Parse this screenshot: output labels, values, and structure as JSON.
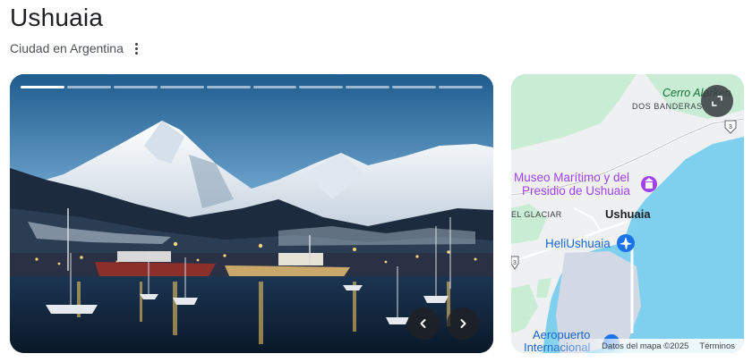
{
  "header": {
    "title": "Ushuaia",
    "subtitle": "Ciudad en Argentina",
    "more_icon": "more-vert-icon"
  },
  "carousel": {
    "slide_count": 10,
    "active_slide": 1,
    "prev_icon": "chevron-left-icon",
    "next_icon": "chevron-right-icon"
  },
  "map": {
    "labels": {
      "cerro": "Cerro Alarken",
      "dos_banderas": "DOS BANDERAS",
      "museo_line1": "Museo Marítimo y del",
      "museo_line2": "Presidio de Ushuaia",
      "glaciar": "EL GLACIAR",
      "city": "Ushuaia",
      "heliport": "HeliUshuaia",
      "airport_line1": "Aeropuerto",
      "airport_line2": "Internacional"
    },
    "route_shields": [
      "3",
      "3"
    ],
    "attribution": "Datos del mapa ©2025",
    "terms": "Términos",
    "expand_icon": "expand-icon",
    "colors": {
      "water": "#7fd0ee",
      "land": "#eef0f1",
      "green": "#c9edd4",
      "poi_purple": "#a142f4",
      "transit_blue": "#1a73e8"
    }
  }
}
